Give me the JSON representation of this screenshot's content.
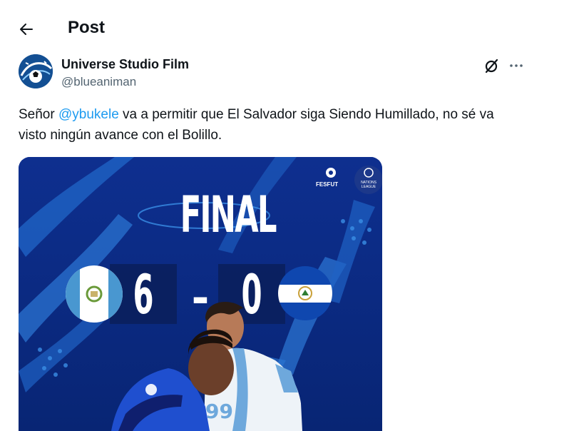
{
  "header": {
    "title": "Post",
    "back_icon": "arrow-left-icon"
  },
  "author": {
    "name": "Universe Studio Film",
    "handle": "@blueaniman"
  },
  "actions": {
    "grok_icon": "grok-icon",
    "more_icon": "more-horizontal-icon"
  },
  "tweet": {
    "text_before": "Señor ",
    "mention": "@ybukele",
    "text_after": " va a permitir que El Salvador siga Siendo Humillado, no sé va visto ningún avance con el Bolillo."
  },
  "media": {
    "headline": "FINAL",
    "home_score": "6",
    "separator": "-",
    "away_score": "0",
    "logo_left": "FESFUT",
    "logo_right": "NATIONS LEAGUE",
    "colors": {
      "background": "#0c2c8a",
      "accent": "#1d9bf0"
    }
  }
}
